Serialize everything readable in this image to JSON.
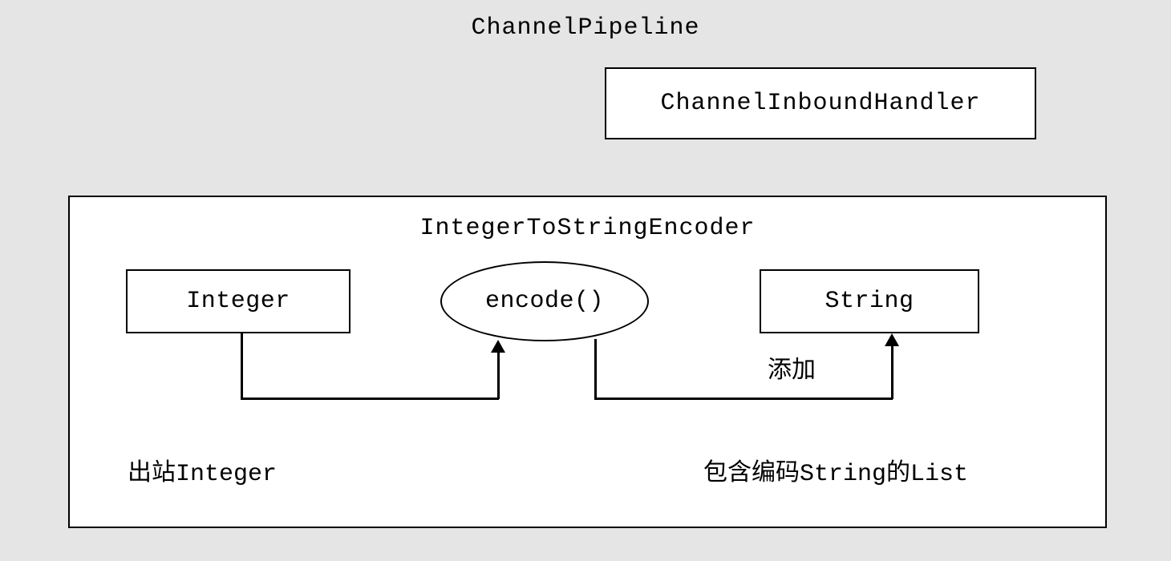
{
  "title": "ChannelPipeline",
  "inboundHandler": "ChannelInboundHandler",
  "encoder": {
    "title": "IntegerToStringEncoder",
    "integerLabel": "Integer",
    "encodeLabel": "encode()",
    "stringLabel": "String",
    "addLabel": "添加",
    "outboundPrefix": "出站",
    "outboundType": "Integer",
    "listPrefix": "包含编码",
    "listType": "String",
    "listSuffix1": "的",
    "listSuffix2": "List"
  }
}
